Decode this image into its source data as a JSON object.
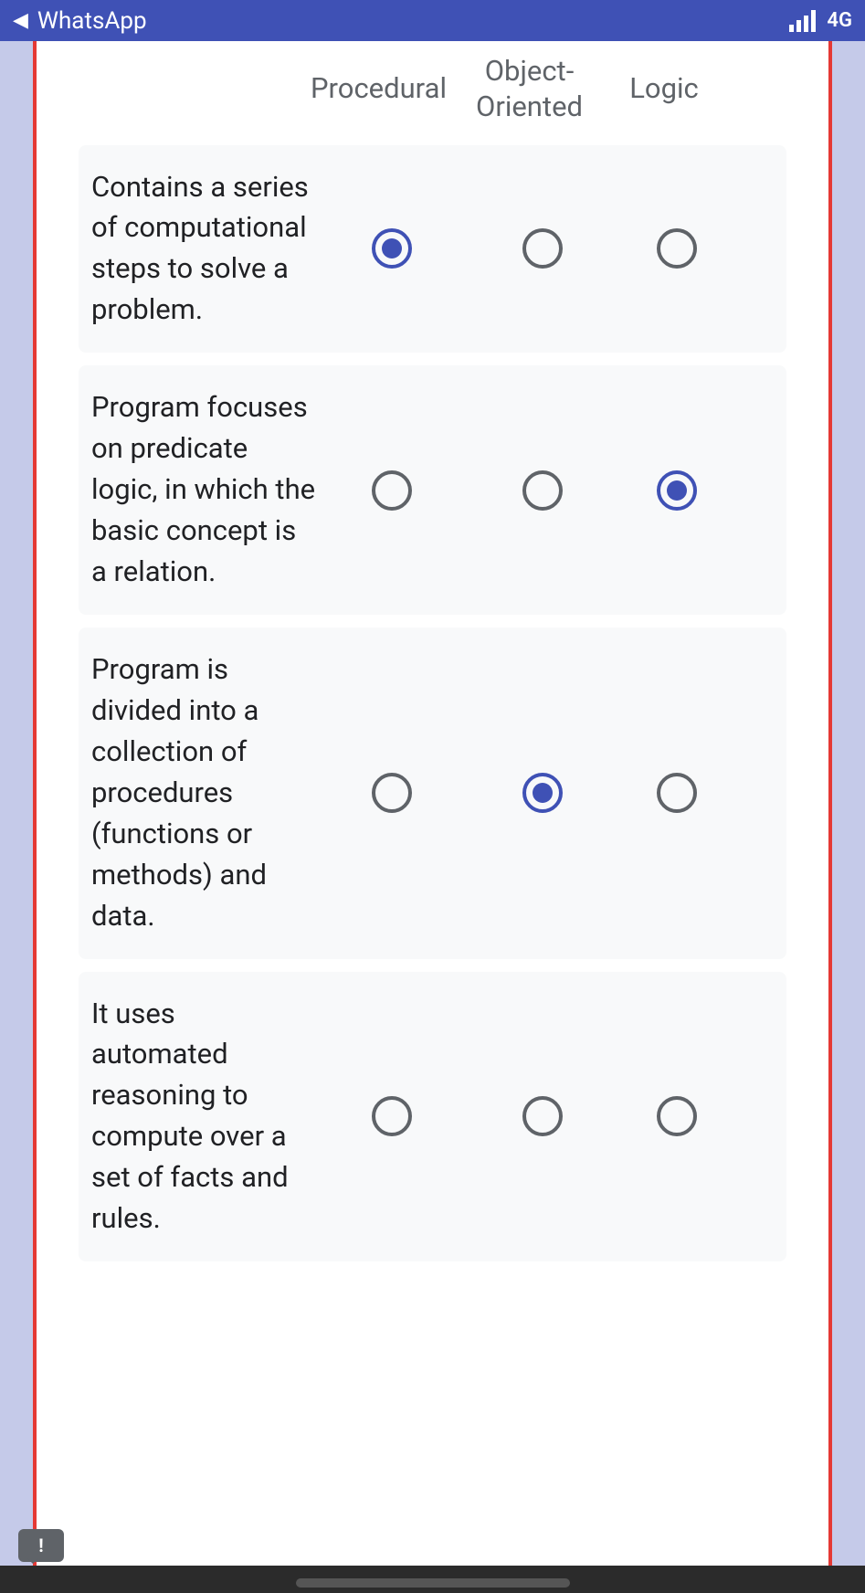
{
  "status": {
    "back_app": "WhatsApp",
    "network_label": "4G"
  },
  "table": {
    "columns": [
      "Procedural",
      "Object-Oriented",
      "Logic"
    ],
    "rows": [
      {
        "label": "Contains a series of computational steps to solve a problem.",
        "selected": 0
      },
      {
        "label": "Program focuses on predicate logic, in which the basic concept is a relation.",
        "selected": 2
      },
      {
        "label": "Program is divided into a collection of procedures (functions or methods) and data.",
        "selected": 1
      },
      {
        "label": "It uses automated reasoning to compute over a set of facts and rules.",
        "selected": -1
      }
    ]
  },
  "feedback_icon_label": "!"
}
